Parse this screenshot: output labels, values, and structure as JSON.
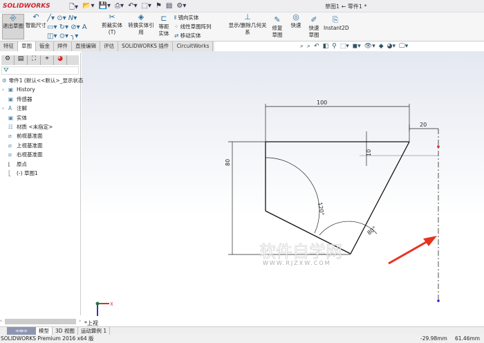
{
  "app": {
    "brand": "SOLIDWORKS",
    "document_title": "草图1 ← 零件1 *"
  },
  "ribbon": {
    "buttons": [
      {
        "label": "退出草图",
        "icon": "exit-sketch-icon"
      },
      {
        "label": "智能尺寸",
        "icon": "smart-dimension-icon"
      },
      {
        "label": "剪裁实体(T)",
        "icon": "trim-icon"
      },
      {
        "label": "转换实体引用",
        "icon": "convert-entities-icon"
      },
      {
        "label": "等距实体",
        "icon": "offset-icon"
      },
      {
        "label": "镜向实体",
        "icon": "mirror-icon"
      },
      {
        "label": "线性草图阵列",
        "icon": "linear-pattern-icon"
      },
      {
        "label": "移动实体",
        "icon": "move-icon"
      },
      {
        "label": "显示/删除几何关系",
        "icon": "relations-icon"
      },
      {
        "label": "修复草图",
        "icon": "repair-sketch-icon"
      },
      {
        "label": "快速",
        "icon": "quick-snaps-icon"
      },
      {
        "label": "快速草图",
        "icon": "rapid-sketch-icon"
      },
      {
        "label": "Instant2D",
        "icon": "instant2d-icon"
      }
    ]
  },
  "tabs": [
    "特征",
    "草图",
    "钣金",
    "焊件",
    "直接编辑",
    "评估",
    "SOLIDWORKS 插件",
    "CircuitWorks"
  ],
  "active_tab": "草图",
  "tree": {
    "root": "零件1 (默认<<默认>_显示状态",
    "items": [
      {
        "label": "History",
        "expand": true
      },
      {
        "label": "传感器",
        "expand": false
      },
      {
        "label": "注解",
        "expand": true
      },
      {
        "label": "实体",
        "expand": false
      },
      {
        "label": "材质 <未指定>",
        "expand": false
      },
      {
        "label": "前视基准面",
        "expand": false
      },
      {
        "label": "上视基准面",
        "expand": false
      },
      {
        "label": "右视基准面",
        "expand": false
      },
      {
        "label": "原点",
        "expand": false
      },
      {
        "label": "(-) 草图1",
        "expand": false
      }
    ]
  },
  "sketch": {
    "dimensions": {
      "top_width": "100",
      "offset_right": "20",
      "offset_small": "10",
      "height": "80",
      "angle_left": "120°",
      "angle_bottom": "80°"
    },
    "view_label": "*上视",
    "axis_x": "X"
  },
  "watermark": {
    "line1": "软件自学网",
    "line2": "WWW.RJZXW.COM"
  },
  "bottom_tabs": [
    "模型",
    "3D 视图",
    "运动算例 1"
  ],
  "status": {
    "product": "SOLIDWORKS Premium 2016 x64 版",
    "x": "-29.98mm",
    "y": "61.46mm"
  },
  "colors": {
    "brand": "#d2232a",
    "arrow": "#e8321e",
    "centerline": "#222222"
  }
}
